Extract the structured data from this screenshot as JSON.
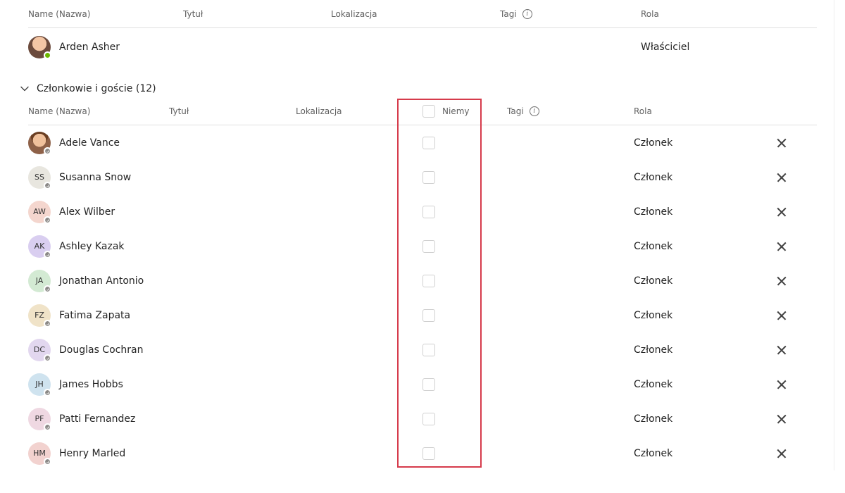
{
  "owner_header": {
    "name": "Name (Nazwa)",
    "title": "Tytuł",
    "location": "Lokalizacja",
    "tags": "Tagi",
    "role": "Rola"
  },
  "owner": {
    "name": "Arden Asher",
    "role": "Właściciel"
  },
  "section": {
    "label": "Członkowie i goście (12)"
  },
  "members_header": {
    "name": "Name (Nazwa)",
    "title": "Tytuł",
    "location": "Lokalizacja",
    "mute": "Niemy",
    "tags": "Tagi",
    "role": "Rola"
  },
  "role_member": "Członek",
  "avatar_colors": {
    "SS": "#e8e6df",
    "AW": "#f4d6ce",
    "AK": "#d9cef0",
    "JA": "#d3ead3",
    "FZ": "#f0e3c8",
    "DC": "#e2d7ef",
    "JH": "#cfe3ef",
    "PF": "#efd8e2",
    "HM": "#f2d2cf"
  },
  "members": [
    {
      "initials": "",
      "photo": true,
      "name": "Adele Vance",
      "role_key": "role_member"
    },
    {
      "initials": "SS",
      "photo": false,
      "name": "Susanna Snow",
      "role_key": "role_member"
    },
    {
      "initials": "AW",
      "photo": false,
      "name": "Alex Wilber",
      "role_key": "role_member"
    },
    {
      "initials": "AK",
      "photo": false,
      "name": "Ashley Kazak",
      "role_key": "role_member"
    },
    {
      "initials": "JA",
      "photo": false,
      "name": "Jonathan Antonio",
      "role_key": "role_member"
    },
    {
      "initials": "FZ",
      "photo": false,
      "name": "Fatima Zapata",
      "role_key": "role_member"
    },
    {
      "initials": "DC",
      "photo": false,
      "name": "Douglas Cochran",
      "role_key": "role_member"
    },
    {
      "initials": "JH",
      "photo": false,
      "name": "James Hobbs",
      "role_key": "role_member"
    },
    {
      "initials": "PF",
      "photo": false,
      "name": "Patti Fernandez",
      "role_key": "role_member"
    },
    {
      "initials": "HM",
      "photo": false,
      "name": "Henry Marled",
      "role_key": "role_member"
    }
  ]
}
